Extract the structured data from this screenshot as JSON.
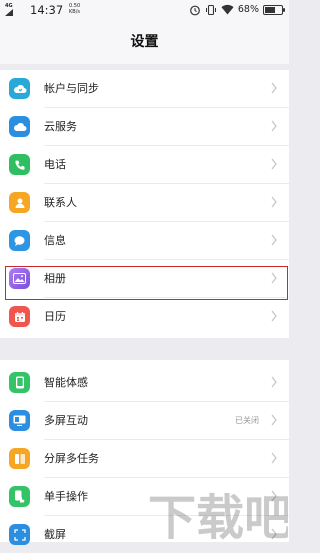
{
  "status_bar": {
    "network": "4G",
    "time": "14:37",
    "speed_value": "0.50",
    "speed_unit": "KB/s",
    "battery_text": "68%",
    "battery_level": 0.68,
    "icons": [
      "alarm-icon",
      "vibrate-icon",
      "wifi-icon",
      "battery-icon"
    ]
  },
  "header": {
    "title": "设置"
  },
  "groups": [
    {
      "items": [
        {
          "label": "帐户与同步",
          "icon": "account-sync-icon",
          "color": "#29a9d8"
        },
        {
          "label": "云服务",
          "icon": "cloud-icon",
          "color": "#2c8ee0"
        },
        {
          "label": "电话",
          "icon": "phone-icon",
          "color": "#2fbf62"
        },
        {
          "label": "联系人",
          "icon": "contacts-icon",
          "color": "#f5a623"
        },
        {
          "label": "信息",
          "icon": "message-icon",
          "color": "#2c95e4"
        },
        {
          "label": "相册",
          "icon": "album-icon",
          "color": "#8a5fe0"
        },
        {
          "label": "日历",
          "icon": "calendar-icon",
          "color": "#f0564d"
        }
      ]
    },
    {
      "items": [
        {
          "label": "智能体感",
          "icon": "motion-icon",
          "color": "#34c467"
        },
        {
          "label": "多屏互动",
          "icon": "multiscreen-icon",
          "color": "#2c8ee0",
          "value": "已关闭"
        },
        {
          "label": "分屏多任务",
          "icon": "split-screen-icon",
          "color": "#f5a623"
        },
        {
          "label": "单手操作",
          "icon": "one-hand-icon",
          "color": "#34c467"
        },
        {
          "label": "截屏",
          "icon": "screenshot-icon",
          "color": "#2c8ee0"
        }
      ]
    }
  ],
  "highlight": {
    "color": "#c9292b"
  },
  "watermark": {
    "text": "下载吧"
  }
}
